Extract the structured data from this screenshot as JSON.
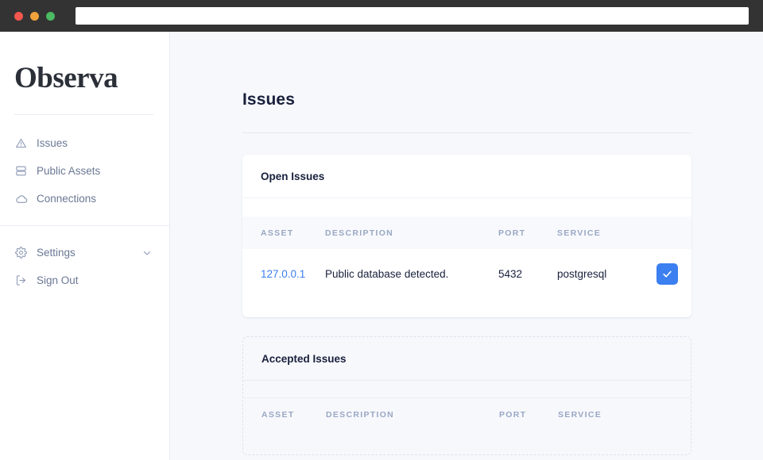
{
  "browser": {
    "url_value": "",
    "url_placeholder": "",
    "traffic_lights": [
      "close",
      "minimize",
      "maximize"
    ]
  },
  "sidebar": {
    "logo": "Observa",
    "primary_items": [
      {
        "label": "Issues",
        "icon": "warning-triangle-icon"
      },
      {
        "label": "Public Assets",
        "icon": "server-stack-icon"
      },
      {
        "label": "Connections",
        "icon": "cloud-icon"
      }
    ],
    "secondary_items": [
      {
        "label": "Settings",
        "icon": "gear-icon",
        "chevron": "chevron-down-icon"
      },
      {
        "label": "Sign Out",
        "icon": "sign-out-icon"
      }
    ]
  },
  "page": {
    "title": "Issues"
  },
  "open_issues": {
    "title": "Open Issues",
    "columns": [
      "ASSET",
      "DESCRIPTION",
      "PORT",
      "SERVICE",
      ""
    ],
    "rows": [
      {
        "asset": "127.0.0.1",
        "description": "Public database detected.",
        "port": "5432",
        "service": "postgresql",
        "action_icon": "check-icon"
      }
    ]
  },
  "accepted_issues": {
    "title": "Accepted Issues",
    "columns": [
      "ASSET",
      "DESCRIPTION",
      "PORT",
      "SERVICE"
    ],
    "rows": []
  },
  "colors": {
    "accent": "#3b7ff0",
    "link": "#3b7ff0",
    "page_bg": "#f7f8fc",
    "heading": "#18203c",
    "muted": "#99a7c4",
    "chrome": "#333333"
  }
}
